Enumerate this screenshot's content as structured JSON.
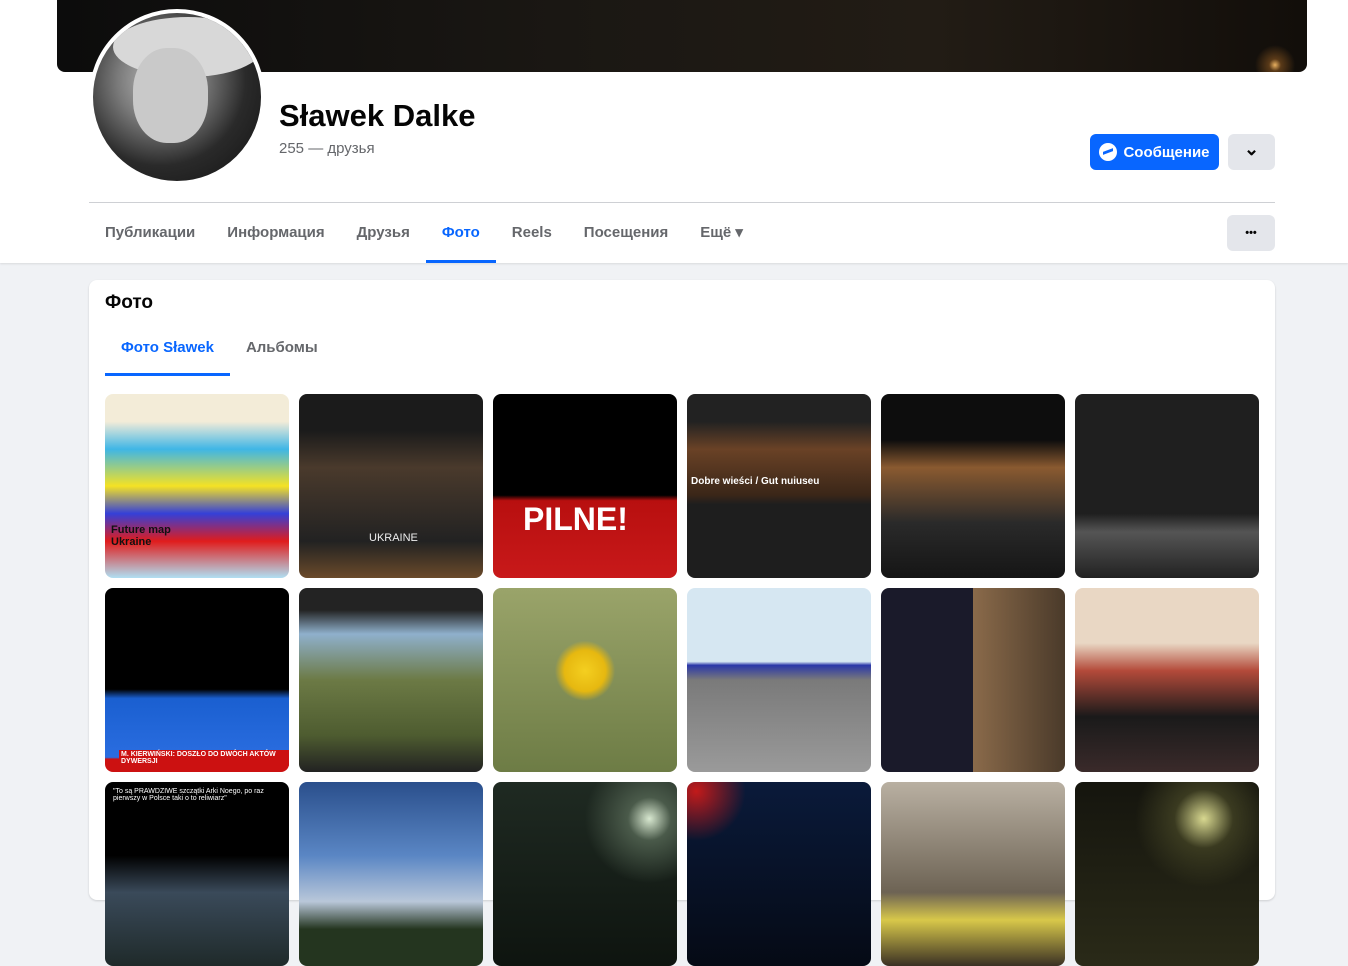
{
  "profile": {
    "name": "Sławek Dalke",
    "friends": "255 — друзья"
  },
  "actions": {
    "message": "Сообщение",
    "dropdown": "⌄",
    "more": "•••"
  },
  "tabs": [
    {
      "label": "Публикации"
    },
    {
      "label": "Информация"
    },
    {
      "label": "Друзья"
    },
    {
      "label": "Фото",
      "active": true
    },
    {
      "label": "Reels"
    },
    {
      "label": "Посещения"
    },
    {
      "label": "Ещё ▾"
    }
  ],
  "photos_section": {
    "title": "Фото",
    "subtabs": [
      {
        "label": "Фото Sławek",
        "active": true
      },
      {
        "label": "Альбомы"
      }
    ]
  },
  "photos": [
    {
      "caption": "Future map Ukraine",
      "bg": "linear-gradient(#f3ecd8,#f3ecd8 15%,#3fb6e6 30%,#f4e224 50%,#3440d8 65%,#e01c1c 80%,#b0dff2)"
    },
    {
      "caption": "UKRAINE",
      "bg": "linear-gradient(#1b1b1b 20%,#4a3a2c 40%,#222 80%,#6b4a2a)"
    },
    {
      "caption": "PILNE!",
      "bg": "linear-gradient(#000 55%,#b80f0f 58%,#c8191a)"
    },
    {
      "caption": "Dobre wieści / Gut nuiuseu",
      "bg": "linear-gradient(#222 15%,#6a4226 30%,#3a2618 55%,#1e1e1e 60%)"
    },
    {
      "caption": "",
      "bg": "linear-gradient(#0d0d0d 25%,#8a5a30 40%,#2a2a2a 70%,#151515)"
    },
    {
      "caption": "",
      "bg": "linear-gradient(#1f1f1f 65%,#555 75%,#222)"
    },
    {
      "caption": "M. KIERWIŃSKI: DOSZŁO DO DWÓCH AKTÓW DYWERSJI",
      "bg": "linear-gradient(#000 55%,#1a5fd0 60%,#2a6de0 92%,#c11 93%)"
    },
    {
      "caption": "",
      "bg": "linear-gradient(#232323 12%,#8fb0cc 25%,#6c7a45 50%,#4e5c30 80%,#222)"
    },
    {
      "caption": "",
      "bg": "radial-gradient(circle at 50% 45%,#f4cf20 0,#e6b810 15%,transparent 22%),linear-gradient(#9aa46a,#6d7c45)"
    },
    {
      "caption": "",
      "bg": "linear-gradient(#d6e7f2 40%,#2a37a8 42%,#7a7a7a 50%,#9a9a9a)"
    },
    {
      "caption": "",
      "bg": "linear-gradient(90deg,#1a1a2a 50%,#8a6a4a 50%,#4a3a2a)"
    },
    {
      "caption": "",
      "bg": "linear-gradient(#e9d7c4 30%,#b34a3a 45%,#1a1a1a 70%,#3a2a2a)"
    },
    {
      "caption": "\"To są PRAWDZIWE szczątki Arki Noego, po raz pierwszy w Polsce taki o to reliwiarz\"",
      "bg": "linear-gradient(#000 40%,#3a4a5a 60%,#1f2a2a)"
    },
    {
      "caption": "",
      "bg": "linear-gradient(#2a4f8c,#5a86c4 40%,#b9c7d9 65%,#24351f 80%)"
    },
    {
      "caption": "",
      "bg": "radial-gradient(circle at 85% 20%,#d8e8d0 0,#4a5a4a 10%,transparent 30%),linear-gradient(#1f2a22,#0e140f)"
    },
    {
      "caption": "",
      "bg": "radial-gradient(circle at 5% 5%,#c21a1a 0,transparent 20%),linear-gradient(#0a1a3a,#050a15)"
    },
    {
      "caption": "",
      "bg": "linear-gradient(#b9b0a2,#6d6354 60%,#d8c84a 75%,#3a3024)"
    },
    {
      "caption": "",
      "bg": "radial-gradient(circle at 70% 20%,#d8d890 0,#3a3a20 15%,transparent 35%),linear-gradient(#15150e,#2a2a18)"
    }
  ]
}
